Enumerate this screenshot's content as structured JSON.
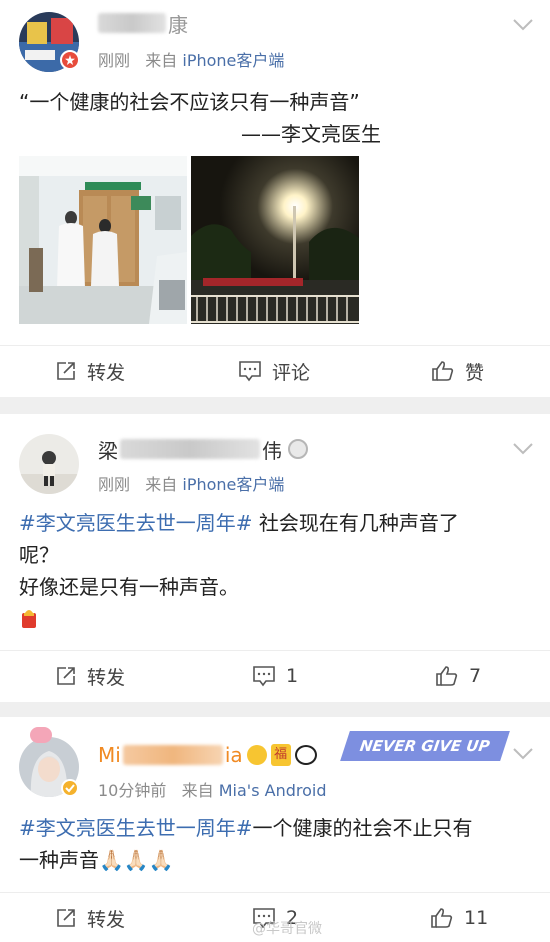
{
  "posts": [
    {
      "meta_time": "刚刚",
      "meta_from": "来自",
      "meta_source": "iPhone客户端",
      "username_visible": "康",
      "content_quote": "“一个健康的社会不应该只有一种声音”",
      "content_attrib": "——李文亮医生",
      "actions": {
        "repost": "转发",
        "comment": "评论",
        "like": "赞"
      }
    },
    {
      "meta_time": "刚刚",
      "meta_from": "来自",
      "meta_source": "iPhone客户端",
      "username_visible_start": "梁",
      "username_visible_end": "伟",
      "hashtag": "#李文亮医生去世一周年#",
      "content_line1": " 社会现在有几种声音了",
      "content_line2": "呢？",
      "content_line3": "好像还是只有一种声音。",
      "actions": {
        "repost": "转发",
        "comment": "1",
        "like": "7"
      }
    },
    {
      "meta_time": "10分钟前",
      "meta_from": "来自",
      "meta_source": "Mia's Android",
      "username_visible_start": "Mi",
      "username_visible_end": "ia",
      "badge_fu": "福",
      "banner_text": "NEVER GIVE UP",
      "hashtag": "#李文亮医生去世一周年#",
      "content_line1": "一个健康的社会不止只有",
      "content_line2": "一种声音🙏🏻🙏🏻🙏🏻",
      "actions": {
        "repost": "转发",
        "comment": "2",
        "like": "11"
      }
    }
  ],
  "watermark": "@华哥官微",
  "colors": {
    "link": "#3d6db0",
    "source": "#4a6fa8",
    "accent": "#ff7a22",
    "meta": "#8b8b8b"
  }
}
